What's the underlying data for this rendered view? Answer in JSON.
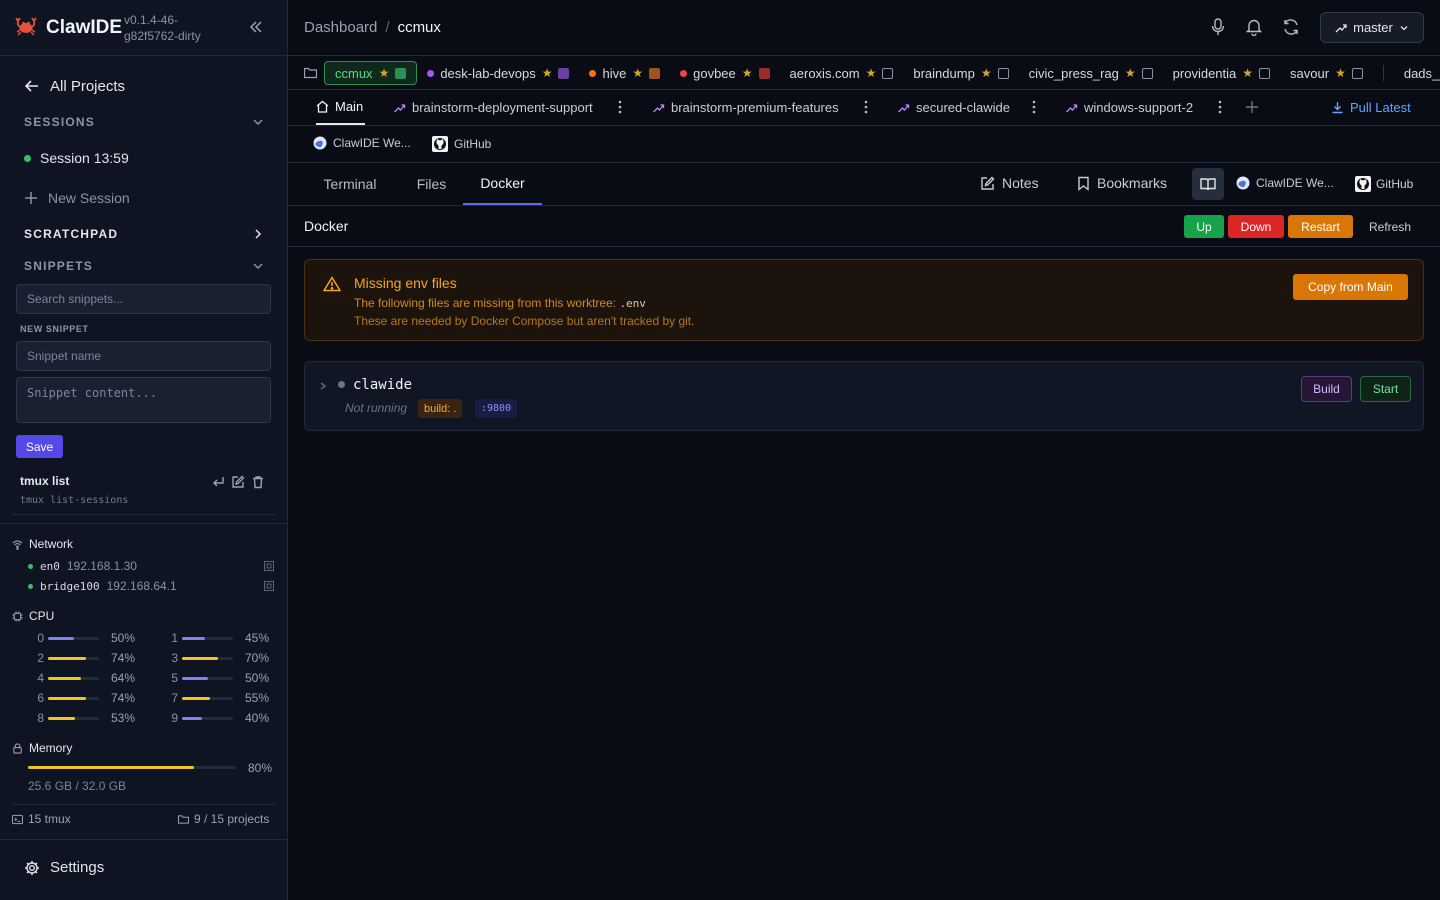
{
  "sidebar": {
    "app_name": "ClawIDE",
    "version": "v0.1.4-46-g82f5762-dirty",
    "all_projects": "All Projects",
    "sessions_header": "SESSIONS",
    "session_item": "Session 13:59",
    "new_session": "New Session",
    "scratchpad_header": "SCRATCHPAD",
    "snippets_header": "SNIPPETS",
    "search_placeholder": "Search snippets...",
    "new_snippet_label": "NEW SNIPPET",
    "snippet_name_placeholder": "Snippet name",
    "snippet_content_placeholder": "Snippet content...",
    "save_label": "Save",
    "snippet": {
      "name": "tmux list",
      "command": "tmux list-sessions"
    },
    "network_header": "Network",
    "network": [
      {
        "iface": "en0",
        "ip": "192.168.1.30"
      },
      {
        "iface": "bridge100",
        "ip": "192.168.64.1"
      }
    ],
    "cpu_header": "CPU",
    "cpu": [
      {
        "core": "0",
        "pct": "50%",
        "value": 50,
        "color": "#7c83f2"
      },
      {
        "core": "1",
        "pct": "45%",
        "value": 45,
        "color": "#7c83f2"
      },
      {
        "core": "2",
        "pct": "74%",
        "value": 74,
        "color": "#f3c51d"
      },
      {
        "core": "3",
        "pct": "70%",
        "value": 70,
        "color": "#f3c51d"
      },
      {
        "core": "4",
        "pct": "64%",
        "value": 64,
        "color": "#f3c51d"
      },
      {
        "core": "5",
        "pct": "50%",
        "value": 50,
        "color": "#7c83f2"
      },
      {
        "core": "6",
        "pct": "74%",
        "value": 74,
        "color": "#f3c51d"
      },
      {
        "core": "7",
        "pct": "55%",
        "value": 55,
        "color": "#f3c51d"
      },
      {
        "core": "8",
        "pct": "53%",
        "value": 53,
        "color": "#f3c51d"
      },
      {
        "core": "9",
        "pct": "40%",
        "value": 40,
        "color": "#7c83f2"
      }
    ],
    "memory_header": "Memory",
    "memory_pct": "80%",
    "memory_value": 80,
    "memory_text": "25.6 GB / 32.0 GB",
    "tmux_count": "15 tmux",
    "projects_count": "9 / 15 projects",
    "settings_label": "Settings"
  },
  "topbar": {
    "crumb_root": "Dashboard",
    "crumb_sep": "/",
    "crumb_current": "ccmux",
    "branch": "master"
  },
  "projects": [
    {
      "name": "ccmux",
      "active": true,
      "dot": null,
      "star": "★",
      "square": "#2f8e58"
    },
    {
      "name": "desk-lab-devops",
      "dot": "#a855f7",
      "star": "★",
      "square": "#6b3fa0"
    },
    {
      "name": "hive",
      "dot": "#f97316",
      "star": "★",
      "square": "#a0521f"
    },
    {
      "name": "govbee",
      "dot": "#ef4444",
      "star": "★",
      "square": "#9b2c2c"
    },
    {
      "name": "aeroxis.com",
      "dot": null,
      "star": "★",
      "square": null
    },
    {
      "name": "braindump",
      "dot": null,
      "star": "★",
      "square": null
    },
    {
      "name": "civic_press_rag",
      "dot": null,
      "star": "★",
      "square": null
    },
    {
      "name": "providentia",
      "dot": null,
      "star": "★",
      "square": null
    },
    {
      "name": "savour",
      "dot": null,
      "star": "★",
      "square": null
    },
    {
      "name": "dads_jou",
      "dot": null,
      "star": null,
      "square": null
    }
  ],
  "branches": {
    "main": "Main",
    "b1": "brainstorm-deployment-support",
    "b2": "brainstorm-premium-features",
    "b3": "secured-clawide",
    "b4": "windows-support-2",
    "pull_latest": "Pull Latest"
  },
  "bookmarks": {
    "web": "ClawIDE We...",
    "github": "GitHub"
  },
  "view_tabs": {
    "terminal": "Terminal",
    "files": "Files",
    "docker": "Docker",
    "notes": "Notes",
    "bookmarks": "Bookmarks",
    "web": "ClawIDE We...",
    "github": "GitHub"
  },
  "docker": {
    "title": "Docker",
    "up": "Up",
    "down": "Down",
    "restart": "Restart",
    "refresh": "Refresh",
    "warning_title": "Missing env files",
    "warning_line1": "The following files are missing from this worktree:",
    "warning_file": ".env",
    "warning_line2": "These are needed by Docker Compose but aren't tracked by git.",
    "copy_from_main": "Copy from Main",
    "service": {
      "name": "clawide",
      "status": "Not running",
      "build_tag": "build: .",
      "port_tag": ":9800",
      "build_btn": "Build",
      "start_btn": "Start"
    }
  },
  "colors": {
    "accent": "#6366f1",
    "success": "#16a34a",
    "danger": "#dc2626",
    "warning": "#d97706",
    "link": "#5ea4ff"
  }
}
